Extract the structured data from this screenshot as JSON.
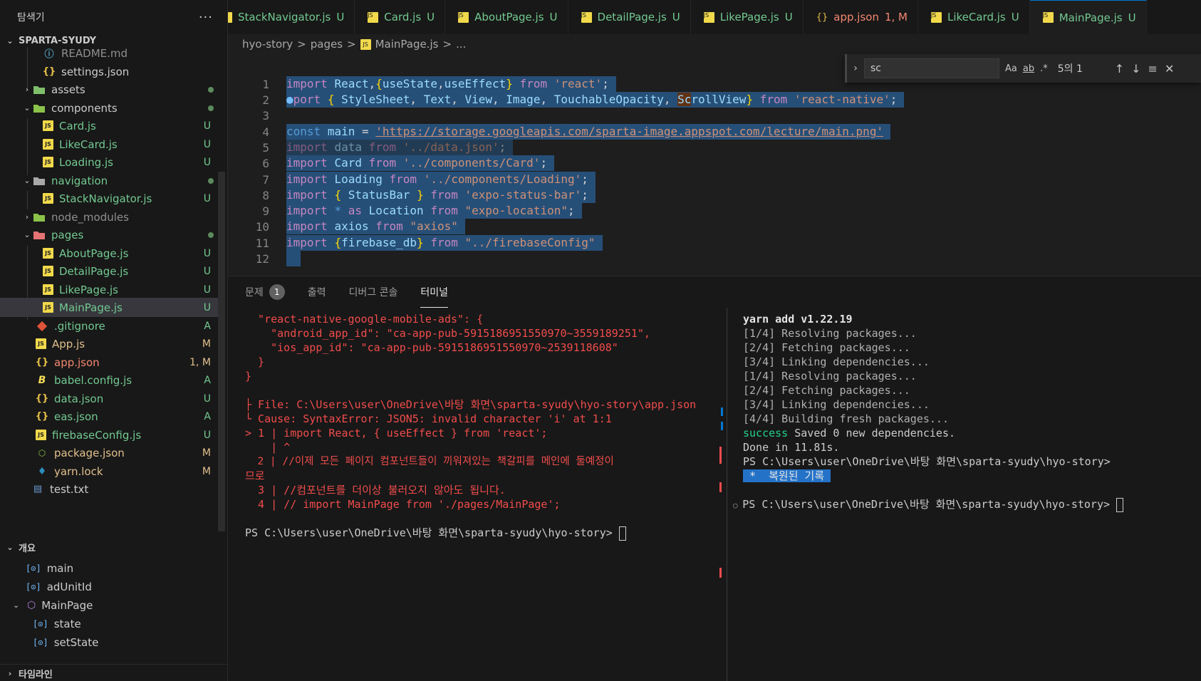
{
  "sidebar": {
    "title": "탐색기",
    "more": "···",
    "root": "SPARTA-SYUDY",
    "items": [
      {
        "label": "README.md",
        "status": ""
      },
      {
        "label": "settings.json",
        "status": ""
      },
      {
        "label": "assets",
        "status": ""
      },
      {
        "label": "components",
        "status": ""
      },
      {
        "label": "Card.js",
        "status": "U"
      },
      {
        "label": "LikeCard.js",
        "status": "U"
      },
      {
        "label": "Loading.js",
        "status": "U"
      },
      {
        "label": "navigation",
        "status": ""
      },
      {
        "label": "StackNavigator.js",
        "status": "U"
      },
      {
        "label": "node_modules",
        "status": ""
      },
      {
        "label": "pages",
        "status": ""
      },
      {
        "label": "AboutPage.js",
        "status": "U"
      },
      {
        "label": "DetailPage.js",
        "status": "U"
      },
      {
        "label": "LikePage.js",
        "status": "U"
      },
      {
        "label": "MainPage.js",
        "status": "U"
      },
      {
        "label": ".gitignore",
        "status": "A"
      },
      {
        "label": "App.js",
        "status": "M"
      },
      {
        "label": "app.json",
        "status": "1, M"
      },
      {
        "label": "babel.config.js",
        "status": "A"
      },
      {
        "label": "data.json",
        "status": "U"
      },
      {
        "label": "eas.json",
        "status": "A"
      },
      {
        "label": "firebaseConfig.js",
        "status": "U"
      },
      {
        "label": "package.json",
        "status": "M"
      },
      {
        "label": "yarn.lock",
        "status": "M"
      },
      {
        "label": "test.txt",
        "status": ""
      }
    ],
    "outline_title": "개요",
    "outline": [
      "main",
      "adUnitId",
      "MainPage",
      "state",
      "setState"
    ],
    "timeline_title": "타임라인"
  },
  "tabs": [
    {
      "label": "StackNavigator.js",
      "status": "U"
    },
    {
      "label": "Card.js",
      "status": "U"
    },
    {
      "label": "AboutPage.js",
      "status": "U"
    },
    {
      "label": "DetailPage.js",
      "status": "U"
    },
    {
      "label": "LikePage.js",
      "status": "U"
    },
    {
      "label": "app.json",
      "status": "1, M"
    },
    {
      "label": "LikeCard.js",
      "status": "U"
    },
    {
      "label": "MainPage.js",
      "status": "U"
    }
  ],
  "breadcrumb": [
    "hyo-story",
    ">",
    "pages",
    ">",
    "MainPage.js",
    ">",
    "..."
  ],
  "find": {
    "value": "sc",
    "match_case": "Aa",
    "whole_word": "ab",
    "regex": ".*",
    "count": "5의 1",
    "prev": "↑",
    "next": "↓",
    "selection": "≡",
    "close": "✕"
  },
  "editor": {
    "line_numbers": [
      "1",
      "2",
      "3",
      "4",
      "5",
      "6",
      "7",
      "8",
      "9",
      "10",
      "11",
      "12"
    ]
  },
  "panel": {
    "tabs": [
      "문제",
      "출력",
      "디버그 콘솔",
      "터미널"
    ],
    "problem_count": "1",
    "left": [
      "  \"react-native-google-mobile-ads\": {",
      "    \"android_app_id\": \"ca-app-pub-5915186951550970~3559189251\",",
      "    \"ios_app_id\": \"ca-app-pub-5915186951550970~2539118608\"",
      "  }",
      "}",
      "",
      "├ File: C:\\Users\\user\\OneDrive\\바탕 화면\\sparta-syudy\\hyo-story\\app.json",
      "└ Cause: SyntaxError: JSON5: invalid character 'i' at 1:1",
      "> 1 | import React, { useEffect } from 'react';",
      "    | ^",
      "  2 | //이제 모든 페이지 컴포넌트들이 끼워져있는 책갈피를 메인에 둘예정이",
      "므로",
      "  3 | //컴포넌트를 더이상 불러오지 않아도 됩니다.",
      "  4 | // import MainPage from './pages/MainPage';",
      "",
      "PS C:\\Users\\user\\OneDrive\\바탕 화면\\sparta-syudy\\hyo-story> "
    ],
    "right": {
      "yarn": "yarn add v1.22.19",
      "steps": [
        "[1/4] Resolving packages...",
        "[2/4] Fetching packages...",
        "[3/4] Linking dependencies...",
        "[1/4] Resolving packages...",
        "[2/4] Fetching packages...",
        "[3/4] Linking dependencies...",
        "[4/4] Building fresh packages..."
      ],
      "success": "success",
      "saved": " Saved 0 new dependencies.",
      "done": "Done in 11.81s.",
      "prompt1": "PS C:\\Users\\user\\OneDrive\\바탕 화면\\sparta-syudy\\hyo-story>",
      "history": " *  복원된 기록 ",
      "prompt2": "PS C:\\Users\\user\\OneDrive\\바탕 화면\\sparta-syudy\\hyo-story> "
    }
  }
}
